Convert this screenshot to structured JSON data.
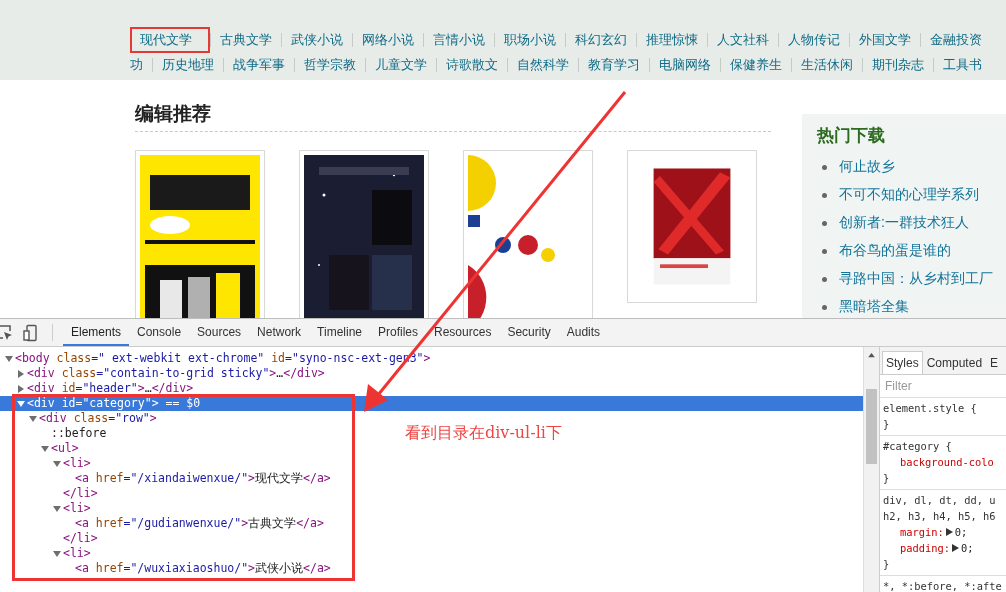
{
  "nav": {
    "top_row": [
      {
        "label": "现代文学",
        "boxed": true
      },
      {
        "label": "古典文学",
        "boxed": false
      },
      {
        "label": "武侠小说",
        "boxed": false
      },
      {
        "label": "网络小说",
        "boxed": false
      },
      {
        "label": "言情小说",
        "boxed": false
      },
      {
        "label": "职场小说",
        "boxed": false
      },
      {
        "label": "科幻玄幻",
        "boxed": false
      },
      {
        "label": "推理惊悚",
        "boxed": false
      },
      {
        "label": "人文社科",
        "boxed": false
      },
      {
        "label": "人物传记",
        "boxed": false
      },
      {
        "label": "外国文学",
        "boxed": false
      },
      {
        "label": "金融投资",
        "boxed": false
      }
    ],
    "bottom_row": [
      {
        "label": "功",
        "boxed": false
      },
      {
        "label": "历史地理",
        "boxed": false
      },
      {
        "label": "战争军事",
        "boxed": false
      },
      {
        "label": "哲学宗教",
        "boxed": false
      },
      {
        "label": "儿童文学",
        "boxed": false
      },
      {
        "label": "诗歌散文",
        "boxed": false
      },
      {
        "label": "自然科学",
        "boxed": false
      },
      {
        "label": "教育学习",
        "boxed": false
      },
      {
        "label": "电脑网络",
        "boxed": false
      },
      {
        "label": "保健养生",
        "boxed": false
      },
      {
        "label": "生活休闲",
        "boxed": false
      },
      {
        "label": "期刊杂志",
        "boxed": false
      },
      {
        "label": "工具书",
        "boxed": false
      }
    ]
  },
  "recommended": {
    "title": "编辑推荐"
  },
  "hot_downloads": {
    "title": "热门下载",
    "items": [
      "何止故乡",
      "不可不知的心理学系列",
      "创新者:一群技术狂人",
      "布谷鸟的蛋是谁的",
      "寻路中国：从乡村到工厂",
      "黑暗塔全集"
    ]
  },
  "devtools": {
    "tabs": [
      {
        "label": "Elements",
        "selected": true
      },
      {
        "label": "Console",
        "selected": false
      },
      {
        "label": "Sources",
        "selected": false
      },
      {
        "label": "Network",
        "selected": false
      },
      {
        "label": "Timeline",
        "selected": false
      },
      {
        "label": "Profiles",
        "selected": false
      },
      {
        "label": "Resources",
        "selected": false
      },
      {
        "label": "Security",
        "selected": false
      },
      {
        "label": "Audits",
        "selected": false
      }
    ],
    "dom_tree": [
      {
        "line": "<body class=\" ext-webkit ext-chrome\" id=\"syno-nsc-ext-gen3\">",
        "expanded": true,
        "selected": false,
        "boxed": false,
        "children": [
          {
            "line": "<div class=\"contain-to-grid sticky\">…</div>",
            "expanded": false,
            "selected": false,
            "boxed": false
          },
          {
            "line": "<div id=\"header\">…</div>",
            "expanded": false,
            "selected": false,
            "boxed": false
          },
          {
            "line": "<div id=\"category\"> == $0",
            "expanded": true,
            "selected": true,
            "boxed": true,
            "children": [
              {
                "line": "<div class=\"row\">",
                "expanded": true,
                "selected": false,
                "boxed": false,
                "children": [
                  {
                    "line": "::before",
                    "selected": false,
                    "boxed": false
                  },
                  {
                    "line": "<ul>",
                    "expanded": true,
                    "selected": false,
                    "boxed": false,
                    "children": [
                      {
                        "line": "<li>",
                        "expanded": true,
                        "selected": false,
                        "boxed": false,
                        "close": "</li>",
                        "children": [
                          {
                            "line": "<a href=\"/xiandaiwenxue/\">现代文学</a>",
                            "selected": false,
                            "boxed": false
                          }
                        ]
                      },
                      {
                        "line": "<li>",
                        "expanded": true,
                        "selected": false,
                        "boxed": false,
                        "close": "</li>",
                        "children": [
                          {
                            "line": "<a href=\"/gudianwenxue/\">古典文学</a>",
                            "selected": false,
                            "boxed": false
                          }
                        ]
                      },
                      {
                        "line": "<li>",
                        "expanded": true,
                        "selected": false,
                        "boxed": false,
                        "children": [
                          {
                            "line": "<a href=\"/wuxiaxiaoshuo/\">武侠小说</a>",
                            "selected": false,
                            "boxed": false
                          }
                        ]
                      }
                    ]
                  }
                ]
              }
            ]
          }
        ]
      }
    ],
    "annotation": "看到目录在div-ul-li下",
    "styles": {
      "tabs": [
        {
          "label": "Styles",
          "selected": true
        },
        {
          "label": "Computed",
          "selected": false
        },
        {
          "label": "E",
          "selected": false
        }
      ],
      "filter_placeholder": "Filter",
      "rules": [
        {
          "selector_lines": [
            "element.style {"
          ],
          "close": "}"
        },
        {
          "selector_lines": [
            "#category {"
          ],
          "declarations": [
            {
              "name": "background-colo",
              "expandable": false
            }
          ],
          "close": "}"
        },
        {
          "selector_lines": [
            "div, dl, dt, dd, u",
            "h2, h3, h4, h5, h6"
          ],
          "declarations": [
            {
              "name": "margin:",
              "value": "0;",
              "expandable": true
            },
            {
              "name": "padding:",
              "value": "0;",
              "expandable": true
            }
          ],
          "close": "}"
        },
        {
          "selector_lines": [
            "*, *:before, *:afte"
          ]
        }
      ]
    }
  }
}
